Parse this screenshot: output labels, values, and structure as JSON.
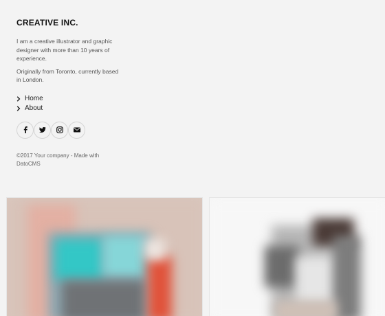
{
  "sidebar": {
    "brand": "CREATIVE INC.",
    "intro_1": "I am a creative illustrator and graphic designer with more than 10 years of experience.",
    "intro_2": "Originally from Toronto, currently based in London.",
    "nav": [
      {
        "label": "Home",
        "icon": "chevron-right-icon"
      },
      {
        "label": "About",
        "icon": "chevron-right-icon"
      }
    ],
    "social": [
      {
        "name": "facebook",
        "icon": "facebook-icon"
      },
      {
        "name": "twitter",
        "icon": "twitter-icon"
      },
      {
        "name": "instagram",
        "icon": "instagram-icon"
      },
      {
        "name": "email",
        "icon": "envelope-icon"
      }
    ],
    "copyright": "©2017 Your company - Made with DatoCMS"
  },
  "colors": {
    "background": "#f3f3f3",
    "text": "#222222",
    "muted": "#555555"
  }
}
